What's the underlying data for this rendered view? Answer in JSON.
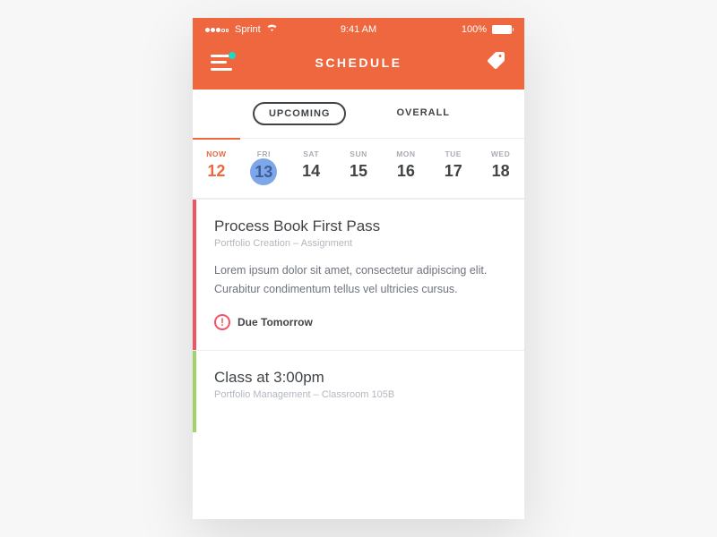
{
  "status": {
    "carrier": "Sprint",
    "time": "9:41 AM",
    "battery": "100%"
  },
  "nav": {
    "title": "SCHEDULE"
  },
  "tabs": {
    "upcoming": "UPCOMING",
    "overall": "OVERALL"
  },
  "days": [
    {
      "label": "NOW",
      "num": "12"
    },
    {
      "label": "FRI",
      "num": "13"
    },
    {
      "label": "SAT",
      "num": "14"
    },
    {
      "label": "SUN",
      "num": "15"
    },
    {
      "label": "MON",
      "num": "16"
    },
    {
      "label": "TUE",
      "num": "17"
    },
    {
      "label": "WED",
      "num": "18"
    }
  ],
  "cards": [
    {
      "title": "Process Book First Pass",
      "sub": "Portfolio Creation – Assignment",
      "body": "Lorem ipsum dolor sit amet, consectetur adipiscing elit. Curabitur condimentum tellus vel ultricies cursus.",
      "due": "Due Tomorrow"
    },
    {
      "title": "Class at 3:00pm",
      "sub": "Portfolio Management – Classroom 105B"
    }
  ]
}
